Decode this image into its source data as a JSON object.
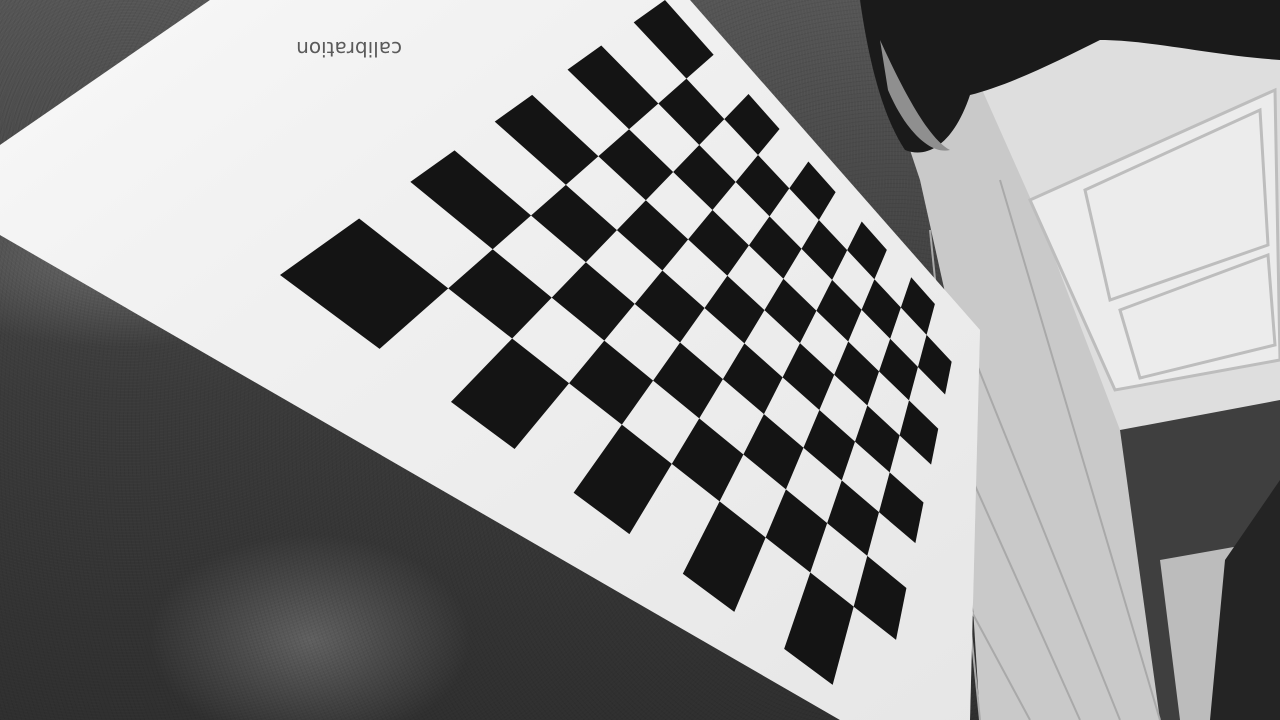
{
  "photo": {
    "subject": "",
    "partial_text": "calibration",
    "board_pattern": {
      "rows": 9,
      "cols": 10,
      "square_color": "#141414",
      "paper_color": "#f2f2f2"
    },
    "palette": {
      "carpet": "#3e3e3e",
      "carpet_highlight": "#8a8a8a",
      "floor_tile": "#cfcfcf",
      "wall": "#d9d9d9",
      "door": "#e6e6e6",
      "shadow": "#1b1b1b"
    }
  }
}
